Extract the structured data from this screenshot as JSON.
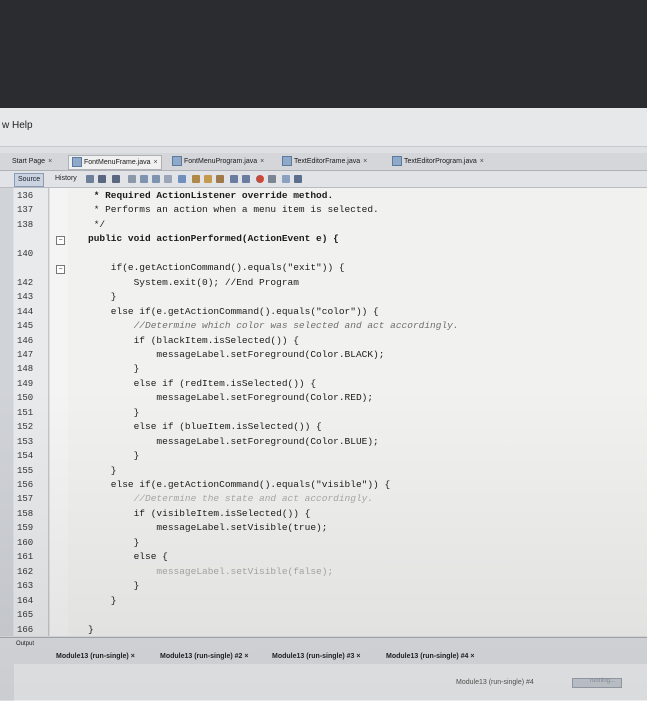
{
  "menu": {
    "help_label": "w Help"
  },
  "tabs": [
    {
      "label": "Start Page"
    },
    {
      "label": "FontMenuFrame.java"
    },
    {
      "label": "FontMenuProgram.java"
    },
    {
      "label": "TextEditorFrame.java"
    },
    {
      "label": "TextEditorProgram.java"
    }
  ],
  "editor_toolbar": {
    "source_label": "Source",
    "history_label": "History"
  },
  "close_glyph": "×",
  "code": {
    "lines": [
      {
        "num": "136",
        "text": " * Required ActionListener override method."
      },
      {
        "num": "137",
        "text": " * Performs an action when a menu item is selected."
      },
      {
        "num": "138",
        "text": " */"
      },
      {
        "num": "",
        "text": "public void actionPerformed(ActionEvent e) {"
      },
      {
        "num": "140",
        "text": ""
      },
      {
        "num": "",
        "text": "    if(e.getActionCommand().equals(\"exit\")) {"
      },
      {
        "num": "142",
        "text": "        System.exit(0); //End Program"
      },
      {
        "num": "143",
        "text": "    }"
      },
      {
        "num": "144",
        "text": "    else if(e.getActionCommand().equals(\"color\")) {"
      },
      {
        "num": "145",
        "text": "        //Determine which color was selected and act accordingly."
      },
      {
        "num": "146",
        "text": "        if (blackItem.isSelected()) {"
      },
      {
        "num": "147",
        "text": "            messageLabel.setForeground(Color.BLACK);"
      },
      {
        "num": "148",
        "text": "        }"
      },
      {
        "num": "149",
        "text": "        else if (redItem.isSelected()) {"
      },
      {
        "num": "150",
        "text": "            messageLabel.setForeground(Color.RED);"
      },
      {
        "num": "151",
        "text": "        }"
      },
      {
        "num": "152",
        "text": "        else if (blueItem.isSelected()) {"
      },
      {
        "num": "153",
        "text": "            messageLabel.setForeground(Color.BLUE);"
      },
      {
        "num": "154",
        "text": "        }"
      },
      {
        "num": "155",
        "text": "    }"
      },
      {
        "num": "156",
        "text": "    else if(e.getActionCommand().equals(\"visible\")) {"
      },
      {
        "num": "157",
        "text": "        //Determine the state and act accordingly."
      },
      {
        "num": "158",
        "text": "        if (visibleItem.isSelected()) {"
      },
      {
        "num": "159",
        "text": "            messageLabel.setVisible(true);"
      },
      {
        "num": "160",
        "text": "        }"
      },
      {
        "num": "161",
        "text": "        else {"
      },
      {
        "num": "162",
        "text": "            messageLabel.setVisible(false);"
      },
      {
        "num": "163",
        "text": "        }"
      },
      {
        "num": "164",
        "text": "    }"
      },
      {
        "num": "165",
        "text": ""
      },
      {
        "num": "166",
        "text": "}"
      }
    ]
  },
  "output": {
    "title": "Output",
    "tabs": [
      {
        "label": "Module13 (run-single)"
      },
      {
        "label": "Module13 (run-single) #2"
      },
      {
        "label": "Module13 (run-single) #3"
      },
      {
        "label": "Module13 (run-single) #4"
      }
    ]
  },
  "status": {
    "task_label": "Module13 (run-single) #4",
    "progress_label": "running..."
  },
  "colors": {
    "editor_bg": "#f1f1f0",
    "gutter_bg": "#e9eaec",
    "selected_tab": "#f0f0f0"
  }
}
